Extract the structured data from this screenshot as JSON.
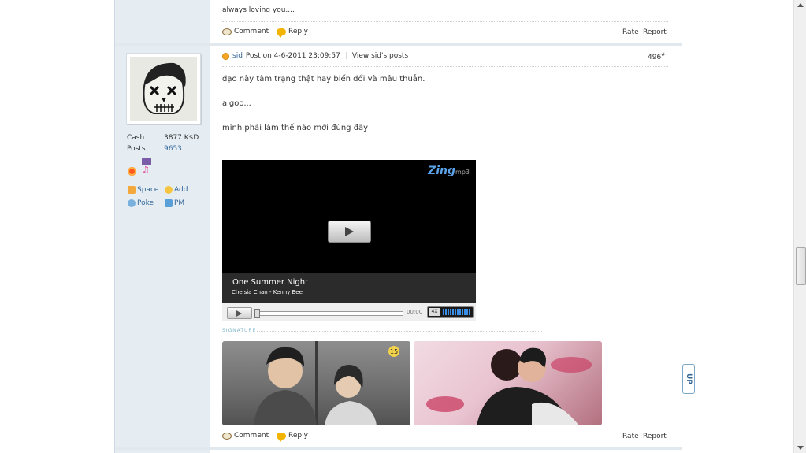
{
  "previous_post": {
    "text": "always loving you....",
    "comment_label": "Comment",
    "reply_label": "Reply",
    "rate_label": "Rate",
    "report_label": "Report"
  },
  "user": {
    "cash_label": "Cash",
    "cash_value": "3877 K$D",
    "posts_label": "Posts",
    "posts_value": "9653",
    "links": {
      "space": "Space",
      "add": "Add",
      "poke": "Poke",
      "pm": "PM"
    }
  },
  "post": {
    "author": "sid",
    "posted": "Post on 4-6-2011 23:09:57",
    "view_posts": "View sid's posts",
    "number": "496",
    "number_suffix": "#",
    "lines": [
      "dạo này tâm trạng thật hay biến đổi và mâu thuẫn.",
      "aigoo...",
      "mình phải làm thế nào mới đúng đây"
    ],
    "player": {
      "brand": "Zing",
      "brand_suffix": "mp3",
      "song_title": "One Summer Night",
      "artists": "Chelsia Chan - Kenny Bee",
      "time": "00:00",
      "mute": "4X"
    },
    "signature_label": "SIGNATURE",
    "photo1_badge": "15",
    "comment_label": "Comment",
    "reply_label": "Reply",
    "rate_label": "Rate",
    "report_label": "Report"
  },
  "up_button": "UP"
}
